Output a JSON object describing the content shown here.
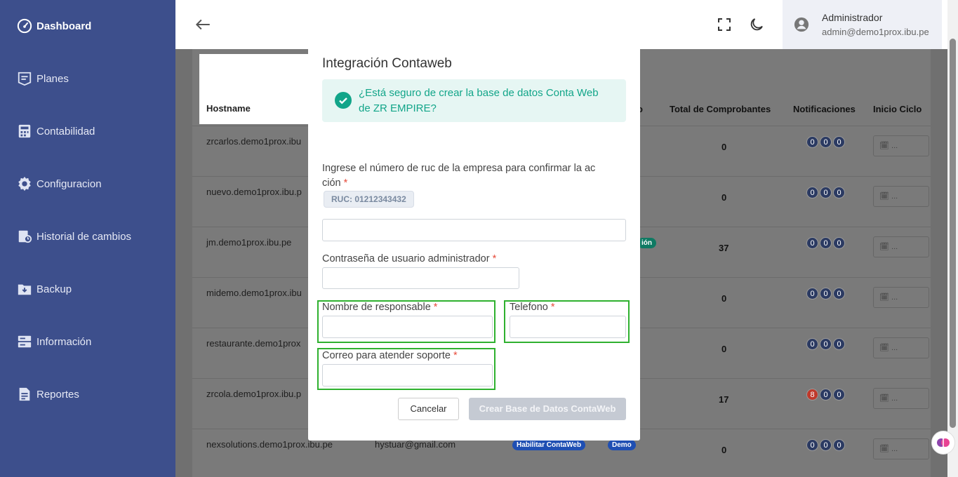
{
  "sidebar": {
    "items": [
      {
        "label": "Dashboard",
        "icon": "speedometer-icon"
      },
      {
        "label": "Planes",
        "icon": "list-icon"
      },
      {
        "label": "Contabilidad",
        "icon": "calculator-icon"
      },
      {
        "label": "Configuracion",
        "icon": "gear-icon"
      },
      {
        "label": "Historial de cambios",
        "icon": "history-icon"
      },
      {
        "label": "Backup",
        "icon": "folder-download-icon"
      },
      {
        "label": "Información",
        "icon": "server-icon"
      },
      {
        "label": "Reportes",
        "icon": "document-icon"
      }
    ]
  },
  "topbar": {
    "user_name": "Administrador",
    "user_email": "admin@demo1prox.ibu.pe"
  },
  "table": {
    "headers": {
      "hostname": "Hostname",
      "partial": "o",
      "total": "Total de Comprobantes",
      "notificaciones": "Notificaciones",
      "inicio": "Inicio Ciclo"
    },
    "rows": [
      {
        "host": "zrcarlos.demo1prox.ibu",
        "total": "0",
        "notif": [
          "0",
          "0",
          "0"
        ]
      },
      {
        "host": "nuevo.demo1prox.ibu.p",
        "total": "0",
        "notif": [
          "0",
          "0",
          "0"
        ]
      },
      {
        "host": "jm.demo1prox.ibu.pe",
        "total": "37",
        "notif": [
          "0",
          "0",
          "0"
        ]
      },
      {
        "host": "midemo.demo1prox.ibu",
        "total": "0",
        "notif": [
          "0",
          "0",
          "0"
        ]
      },
      {
        "host": "restaurante.demo1prox",
        "total": "0",
        "notif": [
          "0",
          "0",
          "0"
        ]
      },
      {
        "host": "zrcola.demo1prox.ibu.p",
        "total": "17",
        "notif": [
          "8",
          "0",
          "0"
        ]
      },
      {
        "host": "nexsolutions.demo1prox.ibu.pe",
        "email": "hystuar@gmail.com",
        "total": "0",
        "notif": [
          "0",
          "0",
          "0"
        ]
      }
    ],
    "row3_pill": "ión",
    "last_row_pills": [
      "Habilitar ContaWeb",
      "Demo"
    ],
    "date_placeholder": "..."
  },
  "modal": {
    "title": "Integración Contaweb",
    "alert_text": "¿Está seguro de crear la base de datos Conta Web de ZR EMPIRE?",
    "ruc_label_line1": "Ingrese el número de ruc de la empresa para confirmar la ac",
    "ruc_label_line2": "ción",
    "ruc_badge": "RUC: 01212343432",
    "password_label": "Contraseña de usuario administrador",
    "responsable_label": "Nombre de responsable",
    "telefono_label": "Telefono",
    "correo_label": "Correo para atender soporte",
    "required_mark": "*",
    "cancel_label": "Cancelar",
    "create_label": "Crear Base de Datos ContaWeb"
  },
  "colors": {
    "sidebar": "#3d4f8c",
    "accent_green": "#12a589",
    "highlight": "#2fb12f"
  }
}
